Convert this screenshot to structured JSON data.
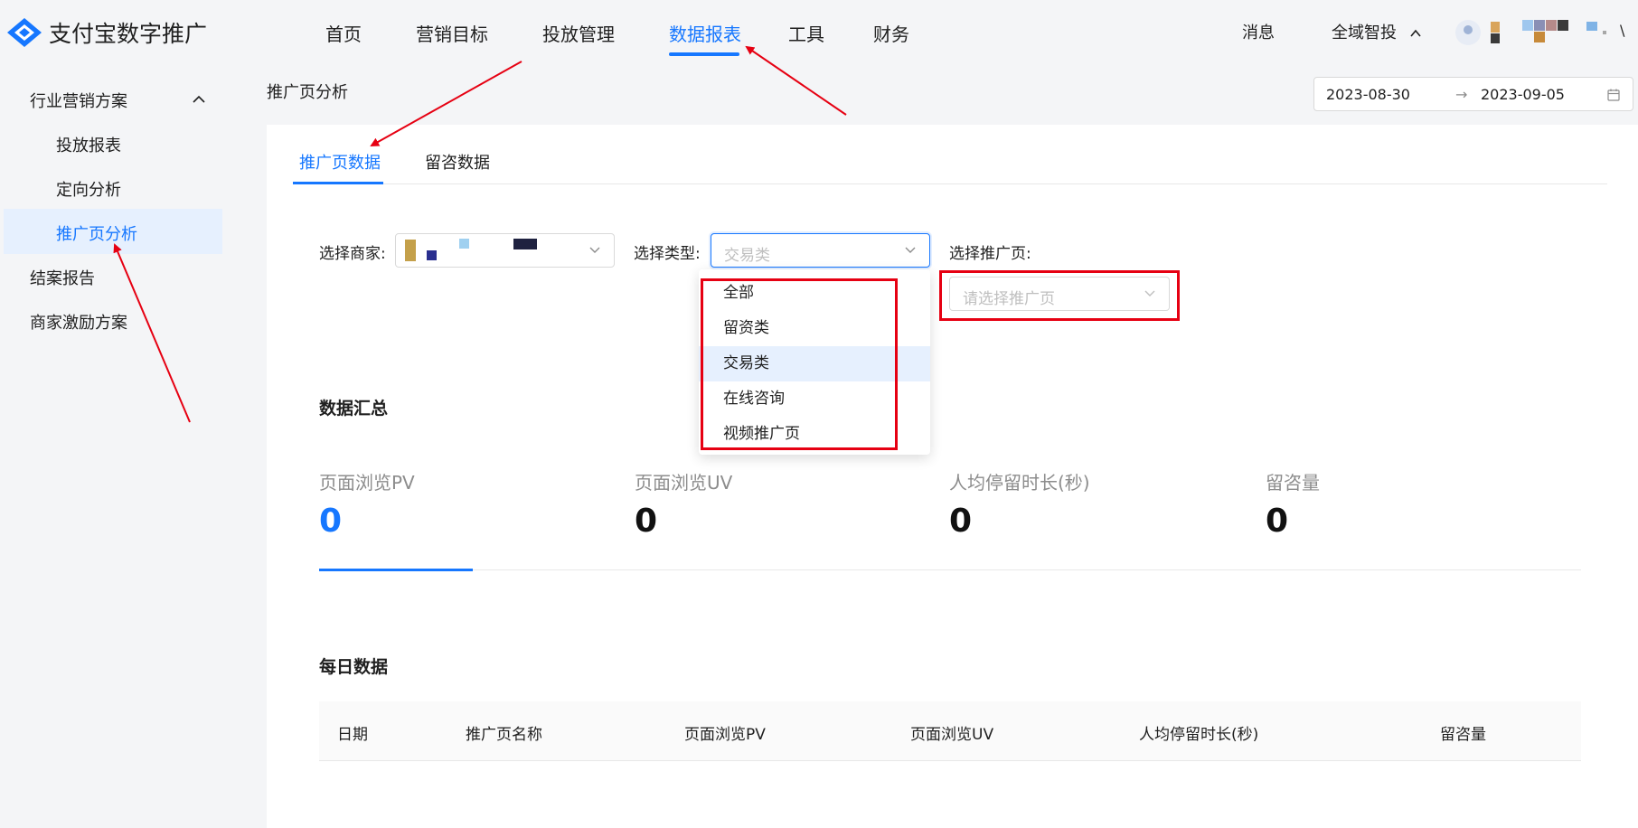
{
  "app": {
    "title": "支付宝数字推广"
  },
  "nav": {
    "items": [
      "首页",
      "营销目标",
      "投放管理",
      "数据报表",
      "工具",
      "财务"
    ],
    "active": "数据报表"
  },
  "header_right": {
    "messages": "消息",
    "workspace": "全域智投",
    "trailing": "\\"
  },
  "sidebar": {
    "group": "行业营销方案",
    "subitems": [
      "投放报表",
      "定向分析",
      "推广页分析"
    ],
    "items": [
      "结案报告",
      "商家激励方案"
    ],
    "active": "推广页分析"
  },
  "breadcrumb": "推广页分析",
  "date_range": {
    "start": "2023-08-30",
    "separator": "→",
    "end": "2023-09-05"
  },
  "tabs": {
    "items": [
      "推广页数据",
      "留咨数据"
    ],
    "active": "推广页数据"
  },
  "filters": {
    "merchant_label": "选择商家:",
    "type_label": "选择类型:",
    "type_value": "交易类",
    "page_label": "选择推广页:",
    "page_placeholder": "请选择推广页"
  },
  "type_dropdown": {
    "options": [
      "全部",
      "留资类",
      "交易类",
      "在线咨询",
      "视频推广页"
    ],
    "selected": "交易类"
  },
  "summary": {
    "title": "数据汇总",
    "stats": [
      {
        "label": "页面浏览PV",
        "value": "0"
      },
      {
        "label": "页面浏览UV",
        "value": "0"
      },
      {
        "label": "人均停留时长(秒)",
        "value": "0"
      },
      {
        "label": "留咨量",
        "value": "0"
      }
    ]
  },
  "daily": {
    "title": "每日数据",
    "columns": [
      "日期",
      "推广页名称",
      "页面浏览PV",
      "页面浏览UV",
      "人均停留时长(秒)",
      "留咨量"
    ]
  },
  "colors": {
    "accent": "#1677ff",
    "annotation": "#e60012"
  }
}
